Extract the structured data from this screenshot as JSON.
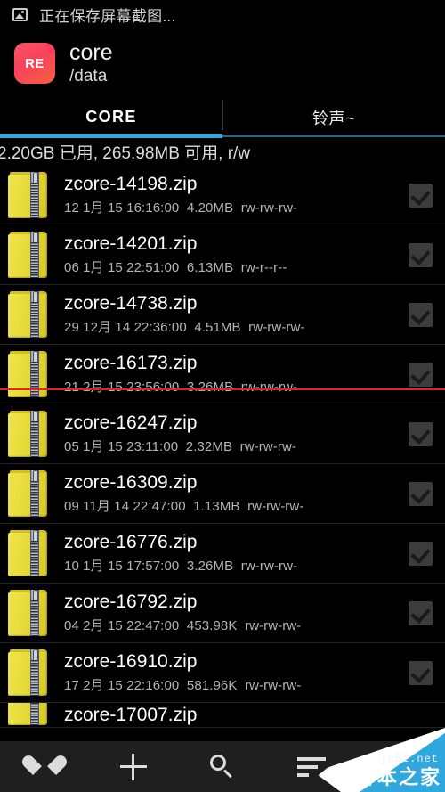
{
  "statusbar": {
    "icon": "image-saving-icon",
    "text": "正在保存屏幕截图..."
  },
  "header": {
    "app_icon_label": "RE",
    "title": "core",
    "subtitle": "/data",
    "accent_color": "#f8415a"
  },
  "tabs": {
    "active_index": 0,
    "indicator_color": "#2fa8e0",
    "items": [
      {
        "label": "CORE"
      },
      {
        "label": "铃声~"
      }
    ]
  },
  "storage": {
    "text": "2.20GB 已用, 265.98MB 可用, r/w"
  },
  "files": {
    "columns": [
      "name",
      "date",
      "time",
      "size",
      "permissions"
    ],
    "items": [
      {
        "name": "zcore-14198.zip",
        "date": "12 1月 15",
        "time": "16:16:00",
        "size": "4.20MB",
        "perm": "rw-rw-rw-",
        "icon": "zip-folder-icon",
        "checked": true
      },
      {
        "name": "zcore-14201.zip",
        "date": "06 1月 15",
        "time": "22:51:00",
        "size": "6.13MB",
        "perm": "rw-r--r--",
        "icon": "zip-folder-icon",
        "checked": true
      },
      {
        "name": "zcore-14738.zip",
        "date": "29 12月 14",
        "time": "22:36:00",
        "size": "4.51MB",
        "perm": "rw-rw-rw-",
        "icon": "zip-folder-icon",
        "checked": true
      },
      {
        "name": "zcore-16173.zip",
        "date": "21 2月 15",
        "time": "23:56:00",
        "size": "3.26MB",
        "perm": "rw-rw-rw-",
        "icon": "zip-folder-icon",
        "checked": true
      },
      {
        "name": "zcore-16247.zip",
        "date": "05 1月 15",
        "time": "23:11:00",
        "size": "2.32MB",
        "perm": "rw-rw-rw-",
        "icon": "zip-folder-icon",
        "checked": true
      },
      {
        "name": "zcore-16309.zip",
        "date": "09 11月 14",
        "time": "22:47:00",
        "size": "1.13MB",
        "perm": "rw-rw-rw-",
        "icon": "zip-folder-icon",
        "checked": true
      },
      {
        "name": "zcore-16776.zip",
        "date": "10 1月 15",
        "time": "17:57:00",
        "size": "3.26MB",
        "perm": "rw-rw-rw-",
        "icon": "zip-folder-icon",
        "checked": true
      },
      {
        "name": "zcore-16792.zip",
        "date": "04 2月 15",
        "time": "22:47:00",
        "size": "453.98K",
        "perm": "rw-rw-rw-",
        "icon": "zip-folder-icon",
        "checked": true
      },
      {
        "name": "zcore-16910.zip",
        "date": "17 2月 15",
        "time": "22:16:00",
        "size": "581.96K",
        "perm": "rw-rw-rw-",
        "icon": "zip-folder-icon",
        "checked": true
      },
      {
        "name": "zcore-17007.zip",
        "date": "",
        "time": "",
        "size": "",
        "perm": "",
        "icon": "zip-folder-icon",
        "checked": true
      }
    ],
    "meta_format": "{date} {time}  {size}  {perm}"
  },
  "toolbar": {
    "buttons": [
      {
        "name": "favorites-button",
        "icon": "heart-icon"
      },
      {
        "name": "add-button",
        "icon": "plus-icon"
      },
      {
        "name": "search-button",
        "icon": "search-icon"
      },
      {
        "name": "sort-button",
        "icon": "sort-icon"
      },
      {
        "name": "more-button",
        "icon": "more-icon"
      }
    ]
  },
  "annotation": {
    "line_color": "#e82020"
  },
  "watermark": {
    "url": "jb51.net",
    "brand": "脚本之家",
    "color": "#31a8dd"
  }
}
